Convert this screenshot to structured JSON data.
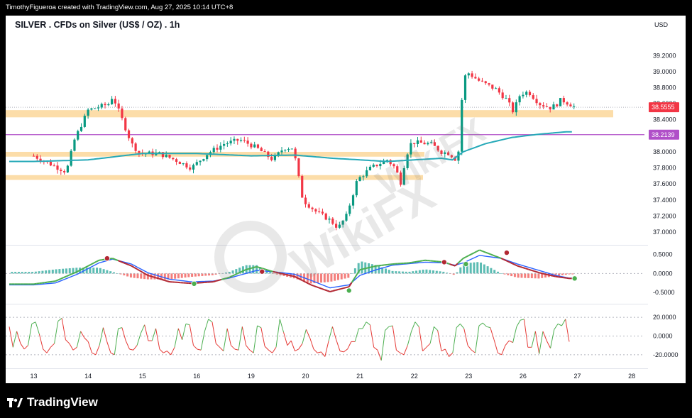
{
  "header": {
    "credit": "TimothyFigueroa created with TradingView.com, Aug 27, 2025 10:14 UTC+8"
  },
  "footer": {
    "brand": "TradingView"
  },
  "watermark": {
    "text": "WikiFX"
  },
  "colors": {
    "up": "#089981",
    "down": "#f23645",
    "ma": "#26a9b8",
    "zone": "#fcd9a0",
    "hline": "#b04fc8",
    "macd_fast": "#2962ff",
    "macd_slow": "#b22833",
    "rsi_up": "#4caf50",
    "rsi_down": "#e53935"
  },
  "chart_data": [
    {
      "type": "candlestick",
      "title": "SILVER . CFDs on Silver (US$ / OZ) . 1h",
      "currency": "USD",
      "ylim": [
        36.85,
        39.45
      ],
      "y_ticks": [
        "39.2000",
        "39.0000",
        "38.8000",
        "38.6000",
        "38.4000",
        "38.2000",
        "38.0000",
        "37.8000",
        "37.6000",
        "37.4000",
        "37.2000",
        "37.0000"
      ],
      "x_ticks": [
        "13",
        "14",
        "15",
        "16",
        "19",
        "20",
        "21",
        "22",
        "23",
        "26",
        "27",
        "28"
      ],
      "last_price": "38.5555",
      "level_line": "38.2139",
      "zones": [
        [
          38.43,
          38.52
        ],
        [
          37.94,
          38.0
        ],
        [
          37.65,
          37.71
        ]
      ],
      "close_path": [
        [
          13,
          37.95
        ],
        [
          13.3,
          37.85
        ],
        [
          13.6,
          37.75
        ],
        [
          13.75,
          38.15
        ],
        [
          14.0,
          38.52
        ],
        [
          14.4,
          38.6
        ],
        [
          14.45,
          38.7
        ],
        [
          14.6,
          38.45
        ],
        [
          14.8,
          38.1
        ],
        [
          14.95,
          37.98
        ],
        [
          15.3,
          37.98
        ],
        [
          15.6,
          37.9
        ],
        [
          15.9,
          37.8
        ],
        [
          16.2,
          37.98
        ],
        [
          16.5,
          38.1
        ],
        [
          16.8,
          38.15
        ],
        [
          17.1,
          38.05
        ],
        [
          17.4,
          37.9
        ],
        [
          17.6,
          38.05
        ],
        [
          17.75,
          38.05
        ],
        [
          17.8,
          37.95
        ],
        [
          17.95,
          37.4
        ],
        [
          18.2,
          37.25
        ],
        [
          18.45,
          37.15
        ],
        [
          18.6,
          37.05
        ],
        [
          18.75,
          37.2
        ],
        [
          18.95,
          37.65
        ],
        [
          19.2,
          37.8
        ],
        [
          19.5,
          37.9
        ],
        [
          19.65,
          37.8
        ],
        [
          19.75,
          37.62
        ],
        [
          19.85,
          37.95
        ],
        [
          19.95,
          38.12
        ],
        [
          20.3,
          38.1
        ],
        [
          20.5,
          38.0
        ],
        [
          20.65,
          37.98
        ],
        [
          20.8,
          37.88
        ],
        [
          20.88,
          38.7
        ],
        [
          20.9,
          38.92
        ],
        [
          21.0,
          38.98
        ],
        [
          21.2,
          38.88
        ],
        [
          21.5,
          38.78
        ],
        [
          21.7,
          38.65
        ],
        [
          21.82,
          38.5
        ],
        [
          21.95,
          38.72
        ],
        [
          22.1,
          38.75
        ],
        [
          22.3,
          38.6
        ],
        [
          22.5,
          38.55
        ],
        [
          22.6,
          38.58
        ],
        [
          22.7,
          38.65
        ],
        [
          22.85,
          38.6
        ],
        [
          22.95,
          38.56
        ]
      ],
      "ma_path": [
        [
          13,
          37.88
        ],
        [
          14,
          37.9
        ],
        [
          15,
          37.98
        ],
        [
          16,
          37.98
        ],
        [
          17,
          37.95
        ],
        [
          17.8,
          37.96
        ],
        [
          18.5,
          37.92
        ],
        [
          19.5,
          37.88
        ],
        [
          20.5,
          37.92
        ],
        [
          20.7,
          37.9
        ],
        [
          20.9,
          38.0
        ],
        [
          21.3,
          38.1
        ],
        [
          21.8,
          38.18
        ],
        [
          22.3,
          38.22
        ],
        [
          22.8,
          38.25
        ]
      ]
    },
    {
      "type": "line",
      "name": "MACD",
      "ylim": [
        -0.78,
        0.72
      ],
      "y_ticks": [
        "0.5000",
        "0.0000",
        "-0.5000"
      ],
      "macd_path": [
        [
          13,
          -0.28
        ],
        [
          13.4,
          -0.2
        ],
        [
          13.8,
          0.05
        ],
        [
          14.2,
          0.35
        ],
        [
          14.45,
          0.4
        ],
        [
          14.8,
          0.2
        ],
        [
          15.1,
          -0.05
        ],
        [
          15.5,
          -0.22
        ],
        [
          15.9,
          -0.26
        ],
        [
          16.3,
          -0.22
        ],
        [
          16.6,
          -0.1
        ],
        [
          16.9,
          0.1
        ],
        [
          17.1,
          0.18
        ],
        [
          17.4,
          0.05
        ],
        [
          17.8,
          -0.08
        ],
        [
          18.1,
          -0.3
        ],
        [
          18.45,
          -0.48
        ],
        [
          18.8,
          -0.35
        ],
        [
          19.0,
          0.1
        ],
        [
          19.3,
          0.2
        ],
        [
          19.6,
          0.25
        ],
        [
          19.9,
          0.28
        ],
        [
          20.2,
          0.35
        ],
        [
          20.55,
          0.3
        ],
        [
          20.75,
          0.2
        ],
        [
          20.9,
          0.4
        ],
        [
          21.2,
          0.62
        ],
        [
          21.6,
          0.4
        ],
        [
          21.9,
          0.2
        ],
        [
          22.3,
          0.02
        ],
        [
          22.6,
          -0.08
        ],
        [
          22.85,
          -0.13
        ]
      ],
      "signal_path": [
        [
          13,
          -0.3
        ],
        [
          13.4,
          -0.25
        ],
        [
          13.8,
          -0.02
        ],
        [
          14.2,
          0.28
        ],
        [
          14.45,
          0.38
        ],
        [
          14.8,
          0.25
        ],
        [
          15.1,
          0.02
        ],
        [
          15.5,
          -0.15
        ],
        [
          15.9,
          -0.22
        ],
        [
          16.3,
          -0.2
        ],
        [
          16.6,
          -0.12
        ],
        [
          16.9,
          0.0
        ],
        [
          17.1,
          0.08
        ],
        [
          17.4,
          0.05
        ],
        [
          17.8,
          -0.02
        ],
        [
          18.1,
          -0.18
        ],
        [
          18.45,
          -0.38
        ],
        [
          18.8,
          -0.3
        ],
        [
          19.0,
          -0.05
        ],
        [
          19.3,
          0.1
        ],
        [
          19.6,
          0.22
        ],
        [
          19.9,
          0.26
        ],
        [
          20.2,
          0.3
        ],
        [
          20.55,
          0.28
        ],
        [
          20.75,
          0.22
        ],
        [
          20.9,
          0.28
        ],
        [
          21.2,
          0.48
        ],
        [
          21.6,
          0.4
        ],
        [
          21.9,
          0.25
        ],
        [
          22.3,
          0.08
        ],
        [
          22.6,
          -0.05
        ],
        [
          22.85,
          -0.12
        ]
      ],
      "crosses": [
        [
          14.35,
          0.4,
          "down"
        ],
        [
          15.95,
          -0.27,
          "up"
        ],
        [
          17.2,
          0.05,
          "down"
        ],
        [
          18.8,
          -0.45,
          "up"
        ],
        [
          20.55,
          0.3,
          "down"
        ],
        [
          20.95,
          0.25,
          "up"
        ],
        [
          21.7,
          0.55,
          "down"
        ],
        [
          22.95,
          -0.13,
          "up"
        ]
      ]
    },
    {
      "type": "line",
      "name": "Oscillator",
      "ylim": [
        -33,
        33
      ],
      "y_ticks": [
        "20.0000",
        "0.0000",
        "-20.0000"
      ],
      "values": [
        10,
        -12,
        5,
        -8,
        -14,
        -10,
        13,
        15,
        2,
        -14,
        -18,
        -12,
        -8,
        16,
        19,
        -4,
        -8,
        -15,
        -12,
        5,
        -2,
        -6,
        -18,
        -20,
        -10,
        9,
        -6,
        -18,
        -20,
        8,
        9,
        -5,
        -14,
        -15,
        -10,
        3,
        12,
        -5,
        -5,
        8,
        -14,
        -18,
        -16,
        -20,
        -12,
        8,
        -4,
        13,
        12,
        -10,
        -14,
        -15,
        5,
        18,
        15,
        -8,
        -12,
        -16,
        8,
        -10,
        -14,
        -15,
        10,
        -10,
        -15,
        -18,
        11,
        9,
        -11,
        -15,
        -18,
        -12,
        18,
        4,
        -10,
        -5,
        -16,
        -14,
        -8,
        7,
        -2,
        -14,
        -18,
        -17,
        -22,
        -5,
        10,
        -4,
        -16,
        -17,
        -14,
        -6,
        -6,
        8,
        8,
        15,
        12,
        -12,
        -15,
        -26,
        6,
        10,
        11,
        -15,
        -18,
        -20,
        -10,
        5,
        15,
        10,
        -16,
        -12,
        -8,
        10,
        6,
        -16,
        -14,
        -22,
        -18,
        9,
        13,
        8,
        -10,
        -15,
        -18,
        11,
        14,
        10,
        9,
        -4,
        -18,
        -20,
        -10,
        -5,
        -7,
        10,
        17,
        18,
        -12,
        -12,
        5,
        -19,
        5,
        -5,
        -13,
        7,
        13,
        11,
        18,
        -6
      ]
    }
  ]
}
